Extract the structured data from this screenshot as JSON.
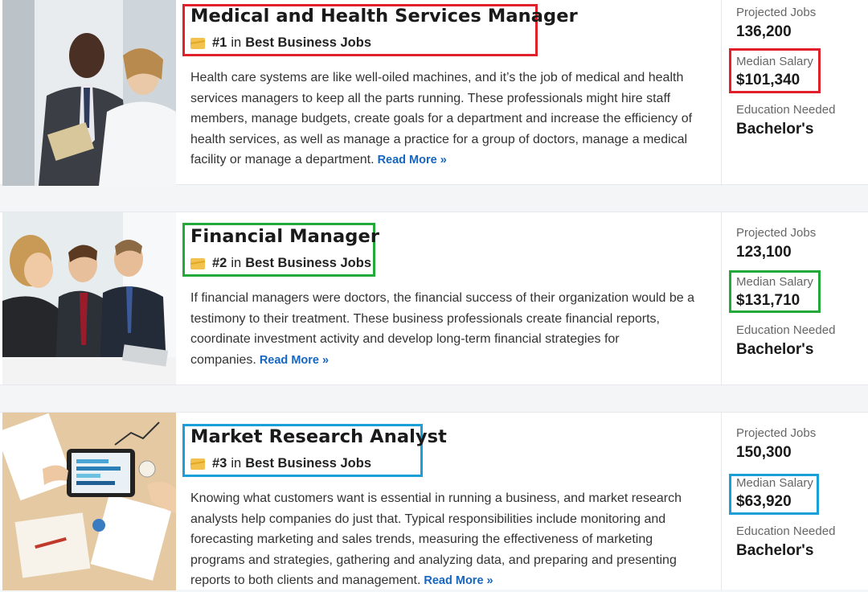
{
  "colors": {
    "red": "#e0202a",
    "green": "#22a93a",
    "blue": "#1a9fd9",
    "link": "#1665c1"
  },
  "labels": {
    "projected": "Projected Jobs",
    "salary": "Median Salary",
    "education": "Education Needed",
    "in": "in",
    "read_more": "Read More »"
  },
  "jobs": [
    {
      "title": "Medical and Health Services Manager",
      "rank": "#1",
      "list": "Best Business Jobs",
      "description": "Health care systems are like well-oiled machines, and it’s the job of medical and health services managers to keep all the parts running. These professionals might hire staff members, manage budgets, create goals for a department and increase the efficiency of health services, as well as manage a practice for a group of doctors, manage a medical facility or manage a department.",
      "projected_jobs": "136,200",
      "median_salary": "$101,340",
      "education": "Bachelor's",
      "highlight": "red",
      "image": "doctors-meeting-photo"
    },
    {
      "title": "Financial Manager",
      "rank": "#2",
      "list": "Best Business Jobs",
      "description": "If financial managers were doctors, the financial success of their organization would be a testimony to their treatment. These business professionals create financial reports, coordinate investment activity and develop long-term financial strategies for companies.",
      "projected_jobs": "123,100",
      "median_salary": "$131,710",
      "education": "Bachelor's",
      "highlight": "green",
      "image": "business-meeting-photo"
    },
    {
      "title": "Market Research Analyst",
      "rank": "#3",
      "list": "Best Business Jobs",
      "description": "Knowing what customers want is essential in running a business, and market research analysts help companies do just that. Typical responsibilities include monitoring and forecasting marketing and sales trends, measuring the effectiveness of marketing programs and strategies, gathering and analyzing data, and preparing and presenting reports to both clients and management.",
      "projected_jobs": "150,300",
      "median_salary": "$63,920",
      "education": "Bachelor's",
      "highlight": "blue",
      "image": "tablet-charts-photo"
    }
  ]
}
